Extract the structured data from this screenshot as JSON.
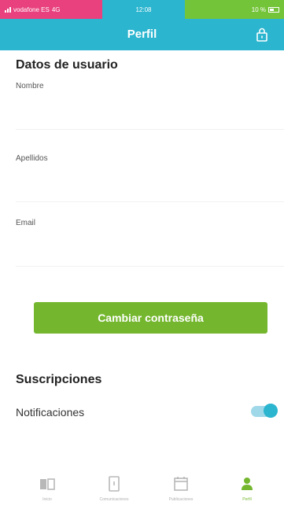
{
  "status_bar": {
    "carrier": "vodafone ES",
    "network": "4G",
    "time": "12:08",
    "battery": "10 %"
  },
  "header": {
    "title": "Perfil"
  },
  "user_data": {
    "section_title": "Datos de usuario",
    "fields": [
      {
        "label": "Nombre",
        "value": ""
      },
      {
        "label": "Apellidos",
        "value": ""
      },
      {
        "label": "Email",
        "value": ""
      }
    ]
  },
  "change_password_button": "Cambiar contraseña",
  "subscriptions": {
    "section_title": "Suscripciones",
    "notifications_label": "Notificaciones",
    "notifications_enabled": true
  },
  "bottom_nav": {
    "items": [
      {
        "label": "Inicio",
        "icon": "book-icon",
        "active": false
      },
      {
        "label": "Comunicaciones",
        "icon": "device-icon",
        "active": false
      },
      {
        "label": "Publicaciones",
        "icon": "calendar-icon",
        "active": false
      },
      {
        "label": "Perfil",
        "icon": "person-icon",
        "active": true
      }
    ]
  },
  "colors": {
    "header": "#2bb5cf",
    "accent_green": "#74b72e",
    "carrier_pink": "#e8417d"
  }
}
